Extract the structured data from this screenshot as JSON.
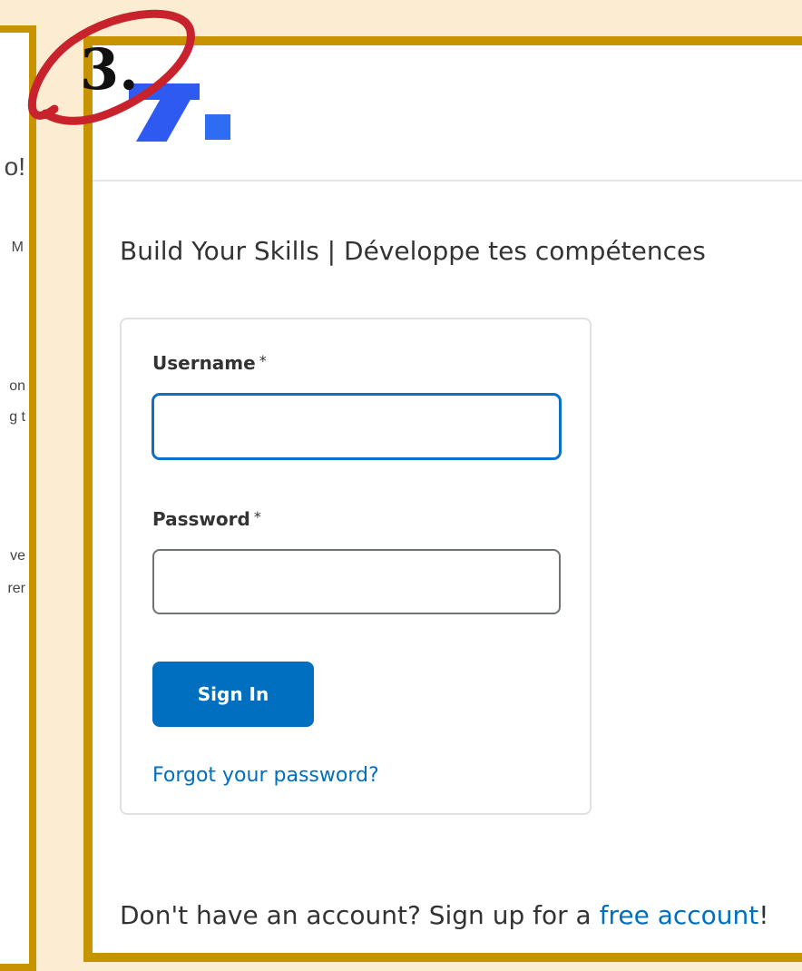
{
  "background_page": {
    "fragments": [
      "o!",
      "M",
      "on",
      "g t",
      "ve",
      "rer"
    ]
  },
  "annotation": {
    "step_label": "3."
  },
  "header": {
    "logo_icon": "d2l-brightspace-logo-icon"
  },
  "main": {
    "page_title": "Build Your Skills | Développe tes compétences"
  },
  "login_form": {
    "username_label": "Username",
    "username_required": "*",
    "username_value": "",
    "password_label": "Password",
    "password_required": "*",
    "password_value": "",
    "sign_in_label": "Sign In",
    "forgot_password_label": "Forgot your password?"
  },
  "signup": {
    "prefix": "Don't have an account? Sign up for a ",
    "link_label": "free account",
    "suffix": "!"
  },
  "colors": {
    "frame_border": "#c79400",
    "page_background": "#fbecd2",
    "primary_button": "#006fbf",
    "link": "#006fbf",
    "focus_ring": "#0f6fc5",
    "logo_blue": "#2f5af2",
    "annotation_red": "#c8232c"
  }
}
